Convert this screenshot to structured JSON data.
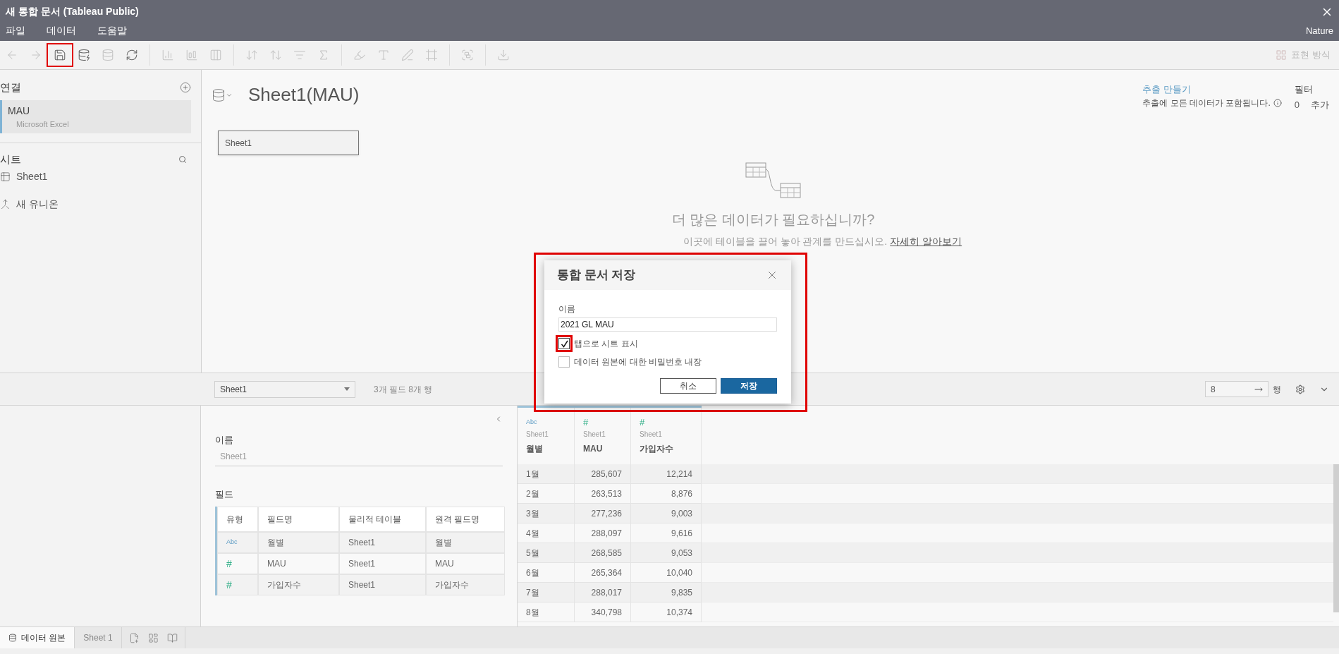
{
  "window": {
    "title": "새 통합 문서 (Tableau Public)"
  },
  "menu": [
    {
      "label": "파일"
    },
    {
      "label": "데이터"
    },
    {
      "label": "도움말"
    }
  ],
  "user": "Nature",
  "toolbar": {
    "show_me": "표현 방식"
  },
  "connections": {
    "title": "연결",
    "items": [
      {
        "name": "MAU",
        "type": "Microsoft Excel",
        "selected": true
      }
    ]
  },
  "sheets": {
    "title": "시트",
    "items": [
      {
        "kind": "table",
        "label": "Sheet1"
      },
      {
        "kind": "union",
        "label": "새 유니온"
      }
    ]
  },
  "canvas": {
    "title": "Sheet1(MAU)",
    "tables": [
      "Sheet1"
    ],
    "prompt": "더 많은 데이터가 필요하십니까?",
    "hint": "이곳에 테이블을 끌어 놓아 관계를 만드십시오.",
    "learn_more": "자세히 알아보기"
  },
  "extract": {
    "link": "추출 만들기",
    "note": "추출에 모든 데이터가 포함됩니다."
  },
  "filters": {
    "label": "필터",
    "count": "0",
    "add": "추가"
  },
  "grid_bar": {
    "table": "Sheet1",
    "summary": "3개 필드 8개 행",
    "rows": "8",
    "rows_label": "행"
  },
  "metadata": {
    "name_label": "이름",
    "name": "Sheet1",
    "fields_label": "필드",
    "columns": [
      "유형",
      "필드명",
      "물리적 테이블",
      "원격 필드명"
    ],
    "rows": [
      {
        "kind": "string",
        "type": "Abc",
        "name": "월별",
        "table": "Sheet1",
        "remote": "월별"
      },
      {
        "kind": "number",
        "type": "#",
        "name": "MAU",
        "table": "Sheet1",
        "remote": "MAU"
      },
      {
        "kind": "number",
        "type": "#",
        "name": "가입자수",
        "table": "Sheet1",
        "remote": "가입자수"
      }
    ]
  },
  "data_grid": {
    "columns": [
      {
        "kind": "string",
        "type": "Abc",
        "table": "Sheet1",
        "name": "월별"
      },
      {
        "kind": "number",
        "type": "#",
        "table": "Sheet1",
        "name": "MAU"
      },
      {
        "kind": "number",
        "type": "#",
        "table": "Sheet1",
        "name": "가입자수"
      }
    ],
    "rows": [
      [
        "1월",
        "285,607",
        "12,214"
      ],
      [
        "2월",
        "263,513",
        "8,876"
      ],
      [
        "3월",
        "277,236",
        "9,003"
      ],
      [
        "4월",
        "288,097",
        "9,616"
      ],
      [
        "5월",
        "268,585",
        "9,053"
      ],
      [
        "6월",
        "265,364",
        "10,040"
      ],
      [
        "7월",
        "288,017",
        "9,835"
      ],
      [
        "8월",
        "340,798",
        "10,374"
      ]
    ]
  },
  "dialog": {
    "title": "통합 문서 저장",
    "name_label": "이름",
    "name_value": "2021 GL MAU",
    "options": [
      {
        "label": "탭으로 시트 표시",
        "checked": true
      },
      {
        "label": "데이터 원본에 대한 비밀번호 내장",
        "checked": false
      }
    ],
    "buttons": [
      {
        "kind": "secondary",
        "label": "취소"
      },
      {
        "kind": "primary",
        "label": "저장"
      }
    ]
  },
  "bottom_tabs": [
    {
      "kind": "data-source",
      "label": "데이터 원본",
      "selected": true
    },
    {
      "kind": "sheet",
      "label": "Sheet 1",
      "selected": false
    }
  ]
}
